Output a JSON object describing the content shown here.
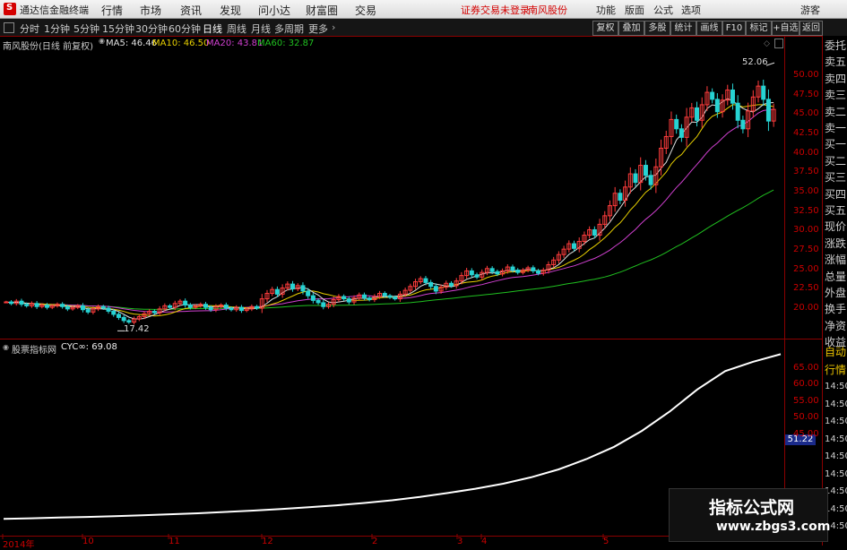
{
  "menubar": {
    "app_title": "通达信金融终端",
    "menus": [
      "行情",
      "市场",
      "资讯",
      "发现",
      "问小达",
      "财富圈",
      "交易"
    ],
    "warning": "证券交易未登录",
    "stock": "南风股份",
    "right_items": [
      "功能",
      "版面",
      "公式",
      "选项"
    ],
    "user": "游客"
  },
  "periodbar": {
    "periods": [
      "分时",
      "1分钟",
      "5分钟",
      "15分钟",
      "30分钟",
      "60分钟",
      "日线",
      "周线",
      "月线",
      "多周期",
      "更多"
    ],
    "active": "日线",
    "tools": [
      "复权",
      "叠加",
      "多股",
      "统计",
      "画线",
      "F10",
      "标记",
      "+自选",
      "返回"
    ]
  },
  "price_panel": {
    "title": "南风股份(日线 前复权)",
    "ma": [
      {
        "label": "MA5: 46.46",
        "color": "#e0e0e0"
      },
      {
        "label": "MA10: 46.50",
        "color": "#e8d000"
      },
      {
        "label": "MA20: 43.81",
        "color": "#d040d0"
      },
      {
        "label": "MA60: 32.87",
        "color": "#20c020"
      }
    ],
    "high_label": "52.06",
    "low_label": "17.42",
    "axis": [
      "50.00",
      "47.50",
      "45.00",
      "42.50",
      "40.00",
      "37.50",
      "35.00",
      "32.50",
      "30.00",
      "27.50",
      "25.00",
      "22.50",
      "20.00"
    ]
  },
  "indicator_panel": {
    "title": "股票指标网",
    "value_label": "CYC∞: 69.08",
    "axis": [
      "65.00",
      "60.00",
      "55.00",
      "50.00",
      "45.00"
    ],
    "current_value": "51.22"
  },
  "date_axis": [
    "2014年",
    "10",
    "11",
    "12",
    "2",
    "3",
    "4",
    "5"
  ],
  "right_panel": {
    "top_items": [
      "委托",
      "卖五",
      "卖四",
      "卖三",
      "卖二",
      "卖一",
      "买一",
      "买二",
      "买三",
      "买四",
      "买五",
      "现价",
      "涨跌",
      "涨幅",
      "总量",
      "外盘",
      "换手",
      "净资",
      "收益"
    ],
    "bottom_items": [
      "自动",
      "行情",
      "14:50",
      "14:50",
      "14:50",
      "14:50",
      "14:50",
      "14:50",
      "14:50",
      "14:50",
      "14:50"
    ]
  },
  "watermark": {
    "title": "指标公式网",
    "url": "www.zbgs3.com"
  },
  "chart_data": [
    {
      "type": "candlestick",
      "title": "南风股份(日线 前复权)",
      "ylim": [
        17,
        53
      ],
      "closes": [
        20.8,
        20.6,
        20.9,
        20.5,
        20.3,
        20.6,
        20.2,
        20.4,
        20.1,
        20.3,
        20.5,
        20.2,
        19.9,
        20.1,
        20.3,
        19.8,
        19.5,
        19.9,
        20.2,
        20.0,
        19.6,
        19.2,
        18.8,
        18.4,
        18.2,
        18.6,
        18.9,
        19.3,
        19.6,
        19.4,
        19.9,
        20.3,
        20.1,
        20.6,
        20.9,
        20.4,
        20.1,
        20.3,
        20.5,
        20.1,
        19.8,
        20.2,
        20.4,
        20.0,
        19.8,
        20.1,
        19.7,
        19.9,
        20.2,
        20.0,
        21.2,
        21.9,
        22.4,
        21.8,
        22.6,
        23.1,
        22.5,
        22.9,
        22.2,
        21.6,
        21.0,
        20.7,
        20.2,
        20.5,
        21.1,
        21.5,
        21.2,
        20.8,
        21.3,
        21.7,
        21.3,
        21.1,
        21.5,
        21.9,
        21.6,
        21.4,
        21.2,
        21.8,
        22.3,
        22.8,
        23.4,
        23.8,
        23.3,
        22.8,
        22.2,
        22.7,
        23.2,
        22.9,
        23.5,
        24.2,
        24.8,
        24.3,
        24.0,
        24.6,
        25.1,
        24.7,
        24.4,
        24.8,
        25.3,
        24.9,
        24.6,
        24.9,
        25.2,
        24.8,
        24.5,
        24.9,
        25.6,
        26.2,
        26.9,
        27.6,
        28.3,
        27.7,
        28.6,
        29.4,
        30.1,
        29.4,
        30.8,
        31.9,
        33.2,
        34.8,
        33.9,
        35.6,
        37.3,
        36.2,
        38.4,
        37.1,
        35.9,
        38.2,
        40.6,
        42.1,
        44.3,
        43.1,
        42.0,
        44.6,
        45.8,
        44.2,
        46.2,
        47.8,
        46.9,
        45.3,
        46.8,
        48.1,
        46.4,
        44.2,
        43.1,
        45.4,
        47.2,
        48.6,
        46.9,
        44.1,
        45.6
      ]
    },
    {
      "type": "line",
      "title": "股票指标网",
      "series": [
        {
          "name": "CYC∞",
          "values": [
            19.5,
            19.7,
            19.9,
            20.1,
            20.3,
            20.6,
            20.9,
            21.2,
            21.6,
            22.0,
            22.5,
            23.0,
            23.6,
            24.3,
            25.1,
            26.1,
            27.3,
            28.6,
            30.1,
            32.0,
            34.4,
            37.5,
            41.2,
            46.0,
            51.8,
            58.5,
            64.0,
            66.8,
            69.08
          ]
        }
      ],
      "ylim": [
        15,
        70
      ]
    }
  ]
}
